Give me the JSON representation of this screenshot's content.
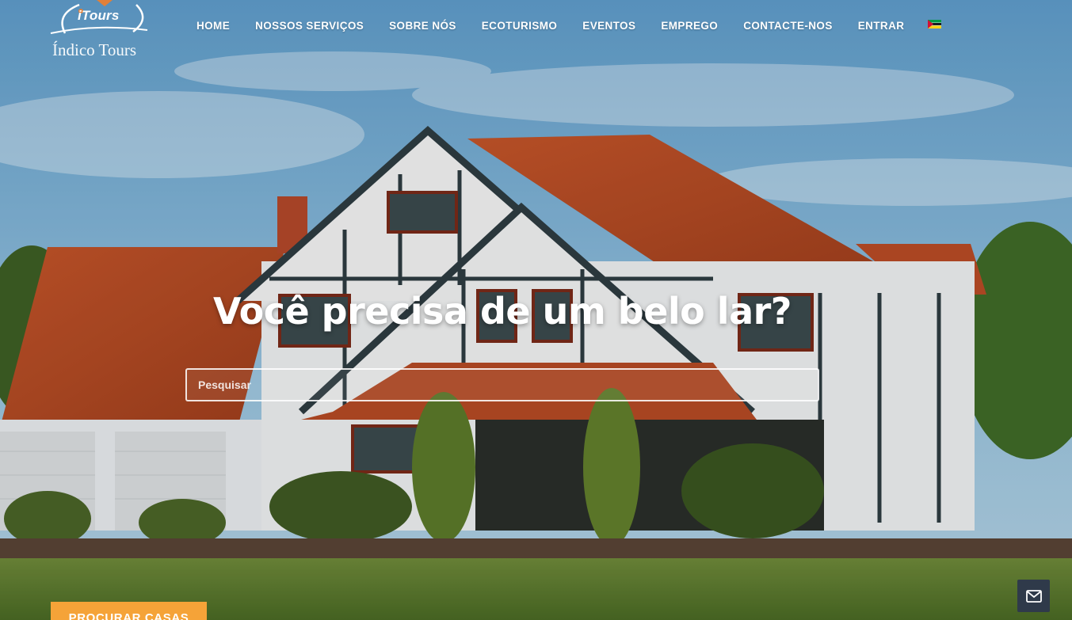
{
  "logo": {
    "badge": "Tours",
    "badge_prefix": "i",
    "name": "Índico Tours"
  },
  "nav": {
    "items": [
      {
        "label": "HOME"
      },
      {
        "label": "NOSSOS SERVIÇOS"
      },
      {
        "label": "SOBRE NÓS"
      },
      {
        "label": "ECOTURISMO"
      },
      {
        "label": "EVENTOS"
      },
      {
        "label": "EMPREGO"
      },
      {
        "label": "CONTACTE-NOS"
      },
      {
        "label": "ENTRAR"
      }
    ],
    "language_flag": "mozambique-flag-icon"
  },
  "hero": {
    "headline": "Você precisa de um belo lar?",
    "search_placeholder": "Pesquisar",
    "cta_label": "PROCURAR CASAS"
  },
  "widgets": {
    "mail_icon": "mail-icon"
  },
  "colors": {
    "accent": "#f5a338",
    "logo_orange": "#e0803a",
    "widget_bg": "#2f3a4a"
  }
}
